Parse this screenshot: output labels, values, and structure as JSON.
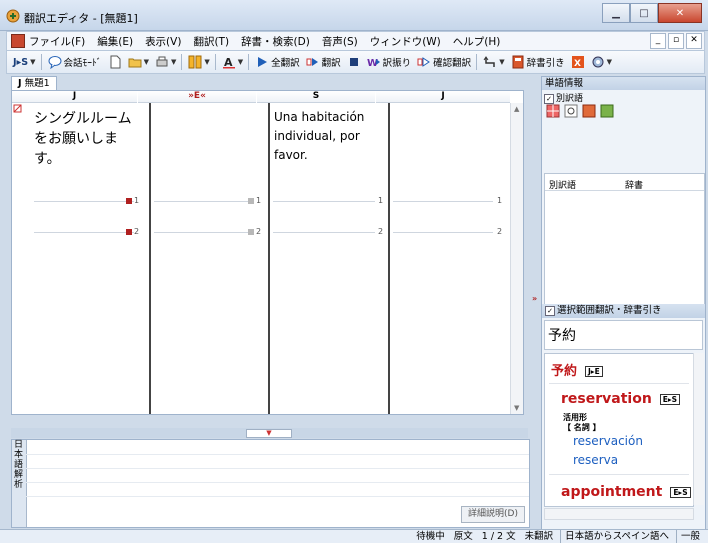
{
  "window": {
    "title": "翻訳エディタ - [無題1]",
    "icon": "translate-app-icon",
    "controls": [
      "minimize",
      "maximize",
      "close"
    ]
  },
  "menu": {
    "items": [
      "ファイル(F)",
      "編集(E)",
      "表示(V)",
      "翻訳(T)",
      "辞書・検索(D)",
      "音声(S)",
      "ウィンドウ(W)",
      "ヘルプ(H)"
    ]
  },
  "toolbar": {
    "direction": "J▸S",
    "conversation_mode": "会話ﾓｰﾄﾞ",
    "translate_all": "全翻訳",
    "translate": "翻訳",
    "alt_translation": "訳振り",
    "confirm_translation": "確認翻訳",
    "dictionary_lookup": "辞書引き"
  },
  "doc_tab": {
    "label": "無題1",
    "prefix": "J"
  },
  "editor": {
    "columns": [
      "J",
      "»E«",
      "S",
      "J"
    ],
    "source_text": [
      "シングルルーム",
      "をお願いしま",
      "す。"
    ],
    "spanish_text": [
      "Una habitación",
      "individual, por",
      "favor."
    ],
    "rows": [
      {
        "col1": "1",
        "col2": "1",
        "col3": "1",
        "col4": "1"
      },
      {
        "col1": "2",
        "col2": "2",
        "col3": "2",
        "col4": "2"
      }
    ]
  },
  "analysis": {
    "tab_label": "日本語解析",
    "detail_button": "詳細説明(D)"
  },
  "side_panel": {
    "header": "単語情報",
    "alt_checkbox": "別訳語",
    "alt_table_headers": [
      "別訳語",
      "辞書"
    ],
    "range_checkbox": "選択範囲翻訳・辞書引き",
    "lookup_word": "予約",
    "dict": {
      "headword": "予約",
      "headword_tag": "J▸E",
      "entries": [
        {
          "word": "reservation",
          "tag": "E▸S",
          "inflection": "活用形",
          "pos": "【 名詞 】",
          "translations": [
            "reservación",
            "reserva"
          ]
        },
        {
          "word": "appointment",
          "tag": "E▸S"
        }
      ]
    }
  },
  "status": {
    "state": "待機中",
    "source": "原文",
    "position": "1 / 2 文",
    "untranslated": "未翻訳",
    "direction": "日本語からスペイン語へ",
    "field": "一般"
  },
  "colors": {
    "accent_red": "#c0181a",
    "link_blue": "#1d5fc0",
    "chrome": "#cfdbe9"
  }
}
